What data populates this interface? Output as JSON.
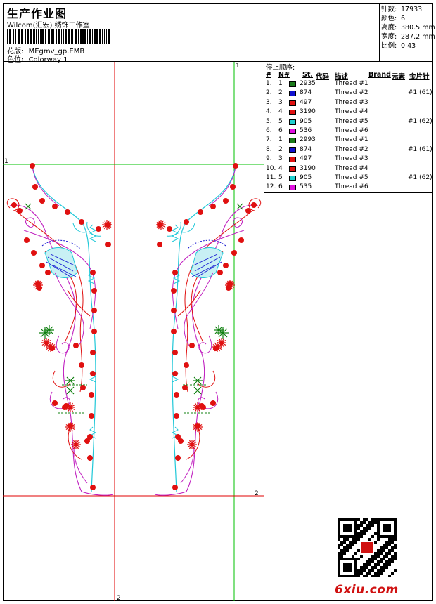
{
  "header": {
    "title": "生产作业图",
    "company": "Wilcom(汇宏) 绣饰工作室",
    "design_label": "花版:",
    "design_value": "MEgmv_gp.EMB",
    "colorway_label": "色位:",
    "colorway_value": "Colorway 1"
  },
  "stats": [
    {
      "label": "针数:",
      "value": "17933"
    },
    {
      "label": "颜色:",
      "value": "6"
    },
    {
      "label": "高度:",
      "value": "380.5 mm"
    },
    {
      "label": "宽度:",
      "value": "287.2 mm"
    },
    {
      "label": "比例:",
      "value": "0.43"
    }
  ],
  "canvas": {
    "marker_top": "1",
    "marker_left": "1",
    "marker_right": "2",
    "marker_bottom": "2"
  },
  "stop_sequence": {
    "title": "停止顺序:",
    "headers": {
      "index": "#",
      "needle": "N#",
      "st": "St.",
      "code": "代码",
      "desc": "描述",
      "brand": "Brand",
      "element": "元素",
      "sequin": "金片针"
    },
    "rows": [
      {
        "index": "1.",
        "needle": "1",
        "color": "#1a7a1a",
        "code": "2935",
        "desc": "Thread #1",
        "sequin": ""
      },
      {
        "index": "2.",
        "needle": "2",
        "color": "#1010d0",
        "code": "874",
        "desc": "Thread #2",
        "sequin": "#1 (61)"
      },
      {
        "index": "3.",
        "needle": "3",
        "color": "#e01010",
        "code": "497",
        "desc": "Thread #3",
        "sequin": ""
      },
      {
        "index": "4.",
        "needle": "4",
        "color": "#e01010",
        "code": "3190",
        "desc": "Thread #4",
        "sequin": ""
      },
      {
        "index": "5.",
        "needle": "5",
        "color": "#20d0d0",
        "code": "905",
        "desc": "Thread #5",
        "sequin": "#1 (62)"
      },
      {
        "index": "6.",
        "needle": "6",
        "color": "#e010e0",
        "code": "536",
        "desc": "Thread #6",
        "sequin": ""
      },
      {
        "index": "7.",
        "needle": "1",
        "color": "#1a7a1a",
        "code": "2993",
        "desc": "Thread #1",
        "sequin": ""
      },
      {
        "index": "8.",
        "needle": "2",
        "color": "#1010d0",
        "code": "874",
        "desc": "Thread #2",
        "sequin": "#1 (61)"
      },
      {
        "index": "9.",
        "needle": "3",
        "color": "#e01010",
        "code": "497",
        "desc": "Thread #3",
        "sequin": ""
      },
      {
        "index": "10.",
        "needle": "4",
        "color": "#e01010",
        "code": "3190",
        "desc": "Thread #4",
        "sequin": ""
      },
      {
        "index": "11.",
        "needle": "5",
        "color": "#20d0d0",
        "code": "905",
        "desc": "Thread #5",
        "sequin": "#1 (62)"
      },
      {
        "index": "12.",
        "needle": "6",
        "color": "#e010e0",
        "code": "535",
        "desc": "Thread #6",
        "sequin": ""
      }
    ]
  },
  "watermark": {
    "text": "6xiu.com"
  },
  "colors": {
    "guide_red": "#e00000",
    "guide_green": "#00c000",
    "stitch_red": "#e01010",
    "stitch_cyan": "#20c8d8",
    "stitch_magenta": "#c020c0",
    "stitch_green": "#108010",
    "stitch_blue": "#1010d0"
  }
}
